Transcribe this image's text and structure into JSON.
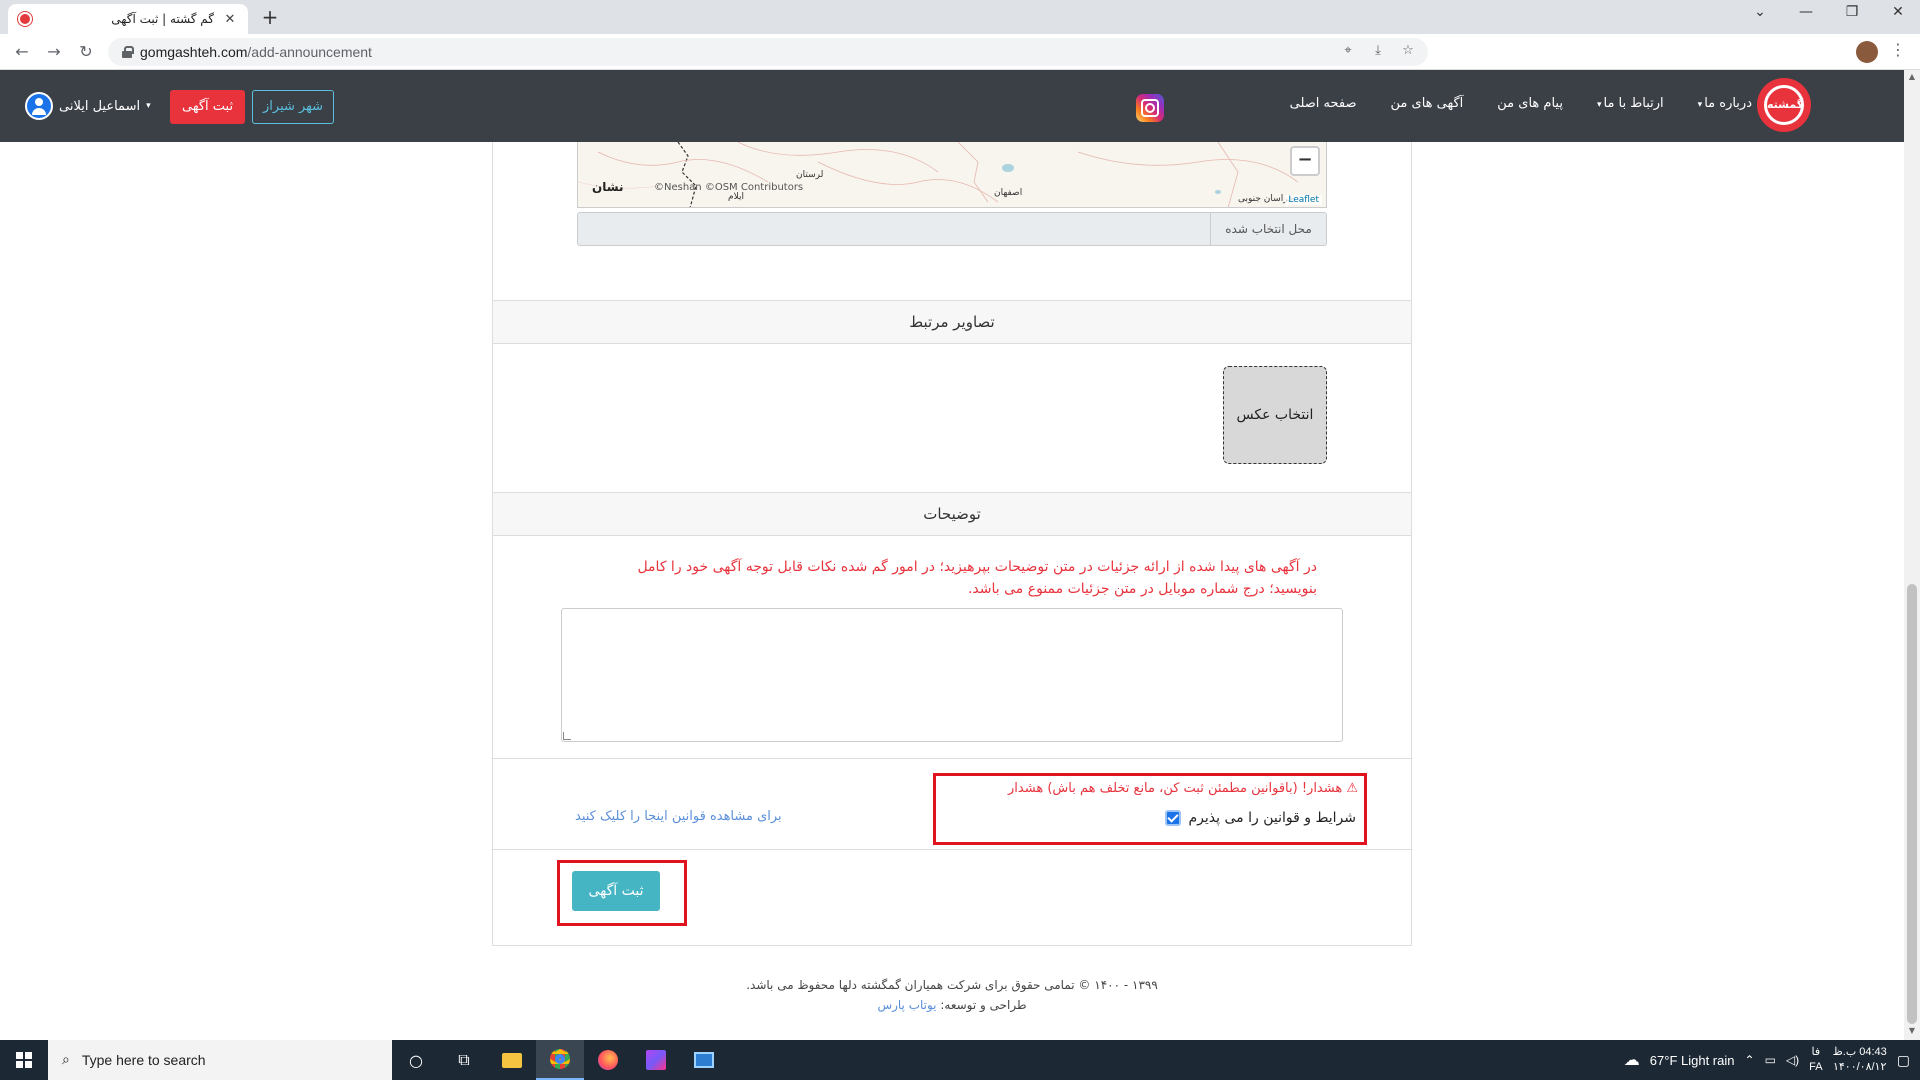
{
  "browser": {
    "tab_title": "گم گشته | ثبت آگهی",
    "tab_close": "✕",
    "new_tab": "+",
    "url_host": "gomgashteh.com",
    "url_path": "/add-announcement",
    "window_controls": [
      "⌄",
      "—",
      "❐",
      "✕"
    ]
  },
  "header": {
    "logo_text": "گمشته",
    "nav": {
      "home": "صفحه اصلی",
      "my_ads": "آگهی های من",
      "my_messages": "پیام های من",
      "contact": "ارتباط با ما",
      "about": "درباره ما"
    },
    "user_name": "اسماعیل ایلانی",
    "register_button": "ثبت آگهی",
    "city_button": "شهر شیراز"
  },
  "map": {
    "zoom_out": "−",
    "brand": "نشان",
    "attribution": "©Neshan ©OSM Contributors",
    "leaflet": "Leaflet",
    "labels": {
      "lorestan": "لرستان",
      "ilam": "ایلام",
      "isfahan": "اصفهان",
      "south_khorasan": "خراسان جنوبی"
    }
  },
  "location": {
    "label": "محل انتخاب شده",
    "value": ""
  },
  "images_section": {
    "title": "تصاویر مرتبط",
    "pick_button": "انتخاب عکس"
  },
  "description_section": {
    "title": "توضیحات",
    "warning": "در آگهی های پیدا شده از ارائه جزئیات در متن توضیحات بپرهیزید؛ در امور گم شده نکات قابل توجه آگهی خود را کامل بنویسید؛ درج شماره موبایل در متن جزئیات ممنوع می باشد.",
    "value": ""
  },
  "terms": {
    "warning": "⚠ هشدار! (باقوانین مطمئن ثبت کن، مانع تخلف هم باش) هشدار",
    "accept_label": "شرایط و قوانین را می پذیرم",
    "accepted": true,
    "view_link": "برای مشاهده قوانین اینجا را کلیک کنید"
  },
  "submit": {
    "label": "ثبت آگهی"
  },
  "footer": {
    "copyright": "۱۳۹۹ - ۱۴۰۰ © تمامی حقوق برای شرکت همیاران گمگشته دلها محفوظ می باشد.",
    "credit_prefix": "طراحی و توسعه: ",
    "credit_link": "یوتاب پارس"
  },
  "taskbar": {
    "search_placeholder": "Type here to search",
    "weather": "67°F  Light rain",
    "lang": "فا",
    "lang2": "FA",
    "time": "04:43 ب.ظ",
    "date": "۱۴۰۰/۰۸/۱۲"
  },
  "colors": {
    "header_bg": "#3b3f46",
    "accent_red": "#e8333d",
    "submit_teal": "#45b5c4",
    "highlight_red": "#e0141e"
  },
  "icons": [
    "favicon",
    "back-icon",
    "forward-icon",
    "reload-icon",
    "lock-icon",
    "location-icon",
    "install-icon",
    "star-icon",
    "instagram-icon",
    "user-avatar-icon",
    "windows-icon",
    "search-icon",
    "chrome-icon",
    "firefox-icon",
    "phpstorm-icon"
  ]
}
